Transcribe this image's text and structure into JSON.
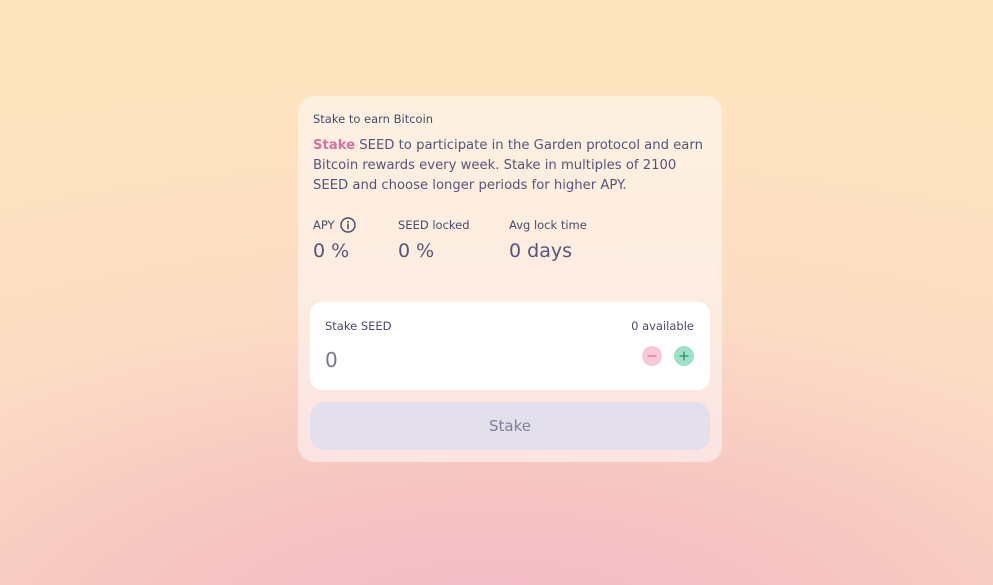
{
  "card": {
    "title": "Stake to earn Bitcoin",
    "description_highlight": "Stake",
    "description_rest": " SEED to participate in the Garden protocol and earn Bitcoin rewards every week. Stake in multiples of 2100 SEED and choose longer periods for higher APY."
  },
  "stats": [
    {
      "label": "APY",
      "value": "0 %"
    },
    {
      "label": "SEED locked",
      "value": "0 %"
    },
    {
      "label": "Avg lock time",
      "value": "0 days"
    }
  ],
  "stake_input": {
    "label": "Stake SEED",
    "available": "0 available",
    "amount": "0"
  },
  "stake_button": {
    "label": "Stake"
  },
  "colors": {
    "highlight": "#d96fa2",
    "minus_button": "#f7c9d8",
    "plus_button": "#9fe0c6",
    "stake_button_bg": "#e3e0ec"
  },
  "icons": {
    "apy_info": "info-icon",
    "decrement": "minus-icon",
    "increment": "plus-icon"
  }
}
